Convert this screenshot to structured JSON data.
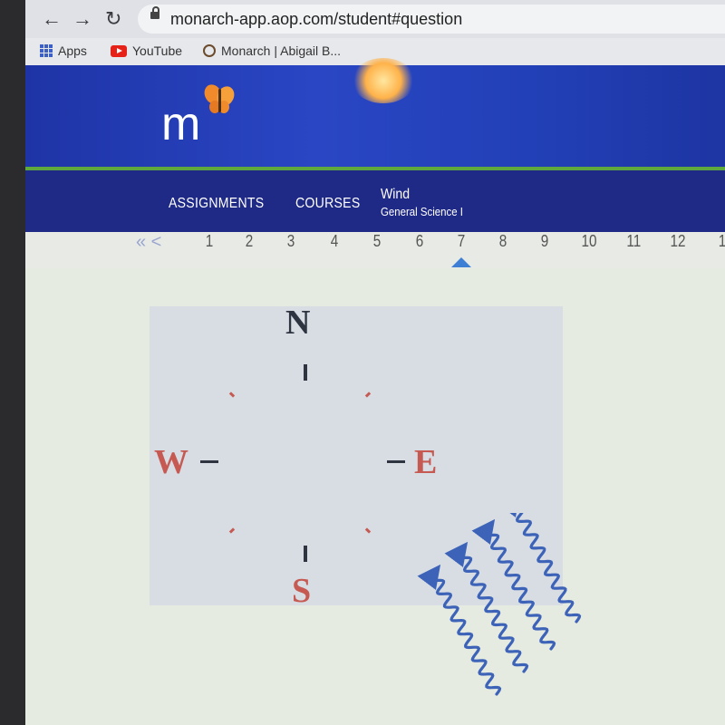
{
  "browser": {
    "back_icon": "←",
    "forward_icon": "→",
    "reload_icon": "↻",
    "url": "monarch-app.aop.com/student#question",
    "bookmarks": [
      {
        "icon": "apps-grid-icon",
        "label": "Apps"
      },
      {
        "icon": "youtube-icon",
        "label": "YouTube"
      },
      {
        "icon": "monarch-icon",
        "label": "Monarch | Abigail B..."
      }
    ]
  },
  "header": {
    "logo_text": "m"
  },
  "nav": {
    "assignments": "ASSIGNMENTS",
    "courses": "COURSES",
    "lesson_title": "Wind",
    "lesson_course": "General Science I"
  },
  "pager": {
    "prev_icon": "« <",
    "pages": [
      "1",
      "2",
      "3",
      "4",
      "5",
      "6",
      "7",
      "8",
      "9",
      "10",
      "11",
      "12",
      "1"
    ],
    "current_page": "7"
  },
  "question": {
    "compass": {
      "north": "N",
      "south": "S",
      "west": "W",
      "east": "E"
    },
    "colors": {
      "north": "#2e3440",
      "south": "#c65a52",
      "west": "#c65a52",
      "east": "#c65a52",
      "wind_arrows": "#3d63b8"
    },
    "wind_arrows_count": 4,
    "wind_direction": "toward northwest"
  }
}
